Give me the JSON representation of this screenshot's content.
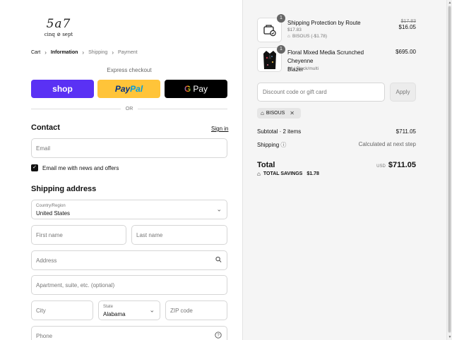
{
  "brand": {
    "logo_big": "5a7",
    "logo_small": "cinq ⊘ sept"
  },
  "breadcrumb": {
    "items": [
      "Cart",
      "Information",
      "Shipping",
      "Payment"
    ]
  },
  "express": {
    "label": "Express checkout",
    "shop": "shop",
    "paypal_a": "Pay",
    "paypal_b": "Pal",
    "gpay_g": "G",
    "gpay": "Pay",
    "or": "OR"
  },
  "contact": {
    "heading": "Contact",
    "signin": "Sign in",
    "email_placeholder": "Email",
    "newsletter_label": "Email me with news and offers",
    "newsletter_checked": true
  },
  "shipping": {
    "heading": "Shipping address",
    "country_label": "Country/Region",
    "country_value": "United States",
    "first_name": "First name",
    "last_name": "Last name",
    "address": "Address",
    "apartment": "Apartment, suite, etc. (optional)",
    "city": "City",
    "state_label": "State",
    "state_value": "Alabama",
    "zip": "ZIP code",
    "phone": "Phone"
  },
  "summary": {
    "items": [
      {
        "qty": "1",
        "name": "Shipping Protection by Route",
        "sub1": "$17.83",
        "discount": "BISOUS (-$1.78)",
        "old_price": "$17.83",
        "price": "$16.05",
        "icon": "shipping-protection-icon"
      },
      {
        "qty": "1",
        "name_line1": "Floral Mixed Media Scrunched Cheyenne",
        "name_line2": "Blazer",
        "variant": "14 / Black/multi",
        "price": "$695.00",
        "icon": "blazer-image"
      }
    ],
    "discount_placeholder": "Discount code or gift card",
    "apply": "Apply",
    "applied_code": "BISOUS",
    "subtotal_label": "Subtotal · 2 items",
    "subtotal_value": "$711.05",
    "shipping_label": "Shipping",
    "shipping_value": "Calculated at next step",
    "total_label": "Total",
    "currency": "USD",
    "total_value": "$711.05",
    "savings_label": "TOTAL SAVINGS",
    "savings_value": "$1.78"
  },
  "colors": {
    "shop": "#5a31f4",
    "paypal": "#ffc439",
    "gpay": "#000000"
  }
}
